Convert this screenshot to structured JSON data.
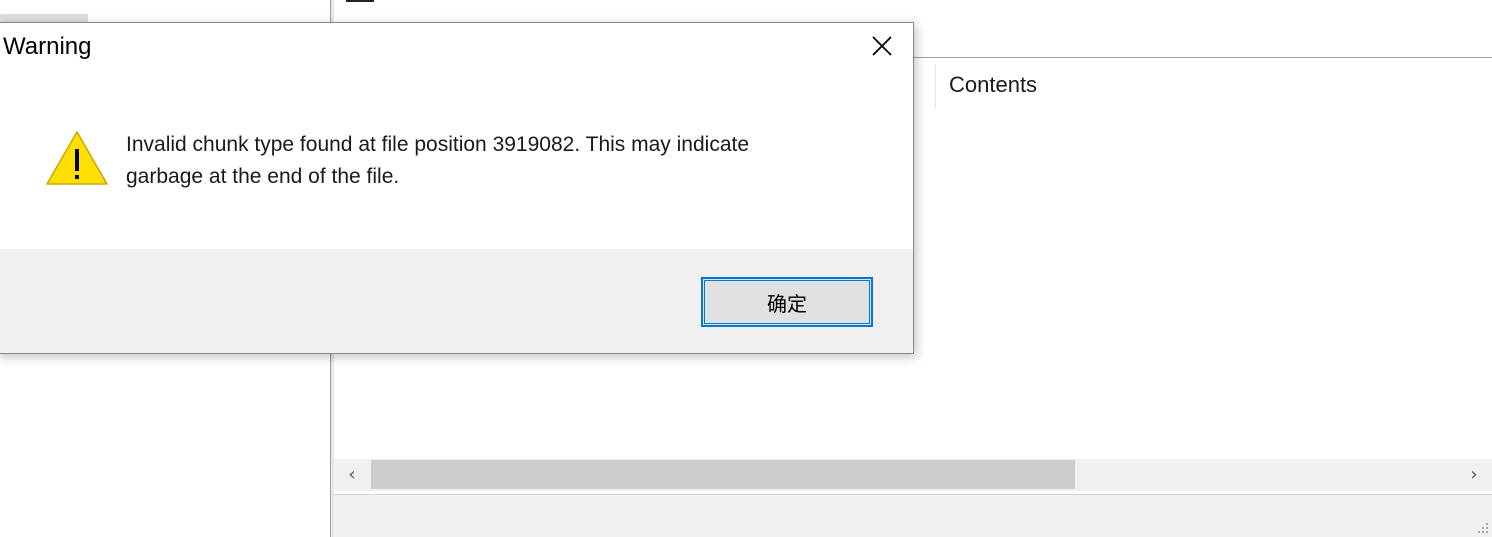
{
  "list": {
    "columns": [
      "Contents"
    ]
  },
  "dialog": {
    "title": "Warning",
    "message_line1": "Invalid chunk type found at file position 3919082. This may indicate",
    "message_line2": "garbage at the end of the file.",
    "ok_label": "确定",
    "icons": {
      "close": "close-icon",
      "warning": "warning-icon"
    }
  },
  "scrollbar": {
    "left_arrow": "‹",
    "right_arrow": "›",
    "icons": {
      "left": "chevron-left-icon",
      "right": "chevron-right-icon"
    }
  },
  "colors": {
    "accent": "#0078d7",
    "warning_fill": "#ffe000",
    "dialog_footer": "#f0f0f0"
  }
}
